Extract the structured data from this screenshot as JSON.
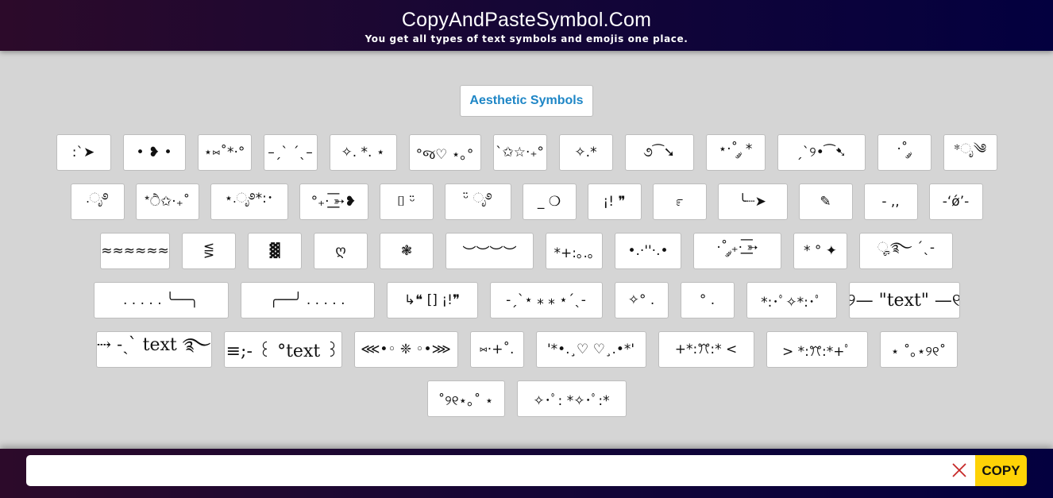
{
  "header": {
    "title": "CopyAndPasteSymbol.Com",
    "subtitle": "You get all types of text symbols and emojis one place."
  },
  "category": {
    "title": "Aesthetic Symbols"
  },
  "symbols": {
    "row1": [
      ":`➤",
      "• ❥ •",
      "⋆⑅˚*·°",
      "–ˏˋ ˊˎ–",
      "✧. *. ⋆",
      "°જ♡ ⋆｡°",
      "ˋ✩☆·₊°",
      "✧.*",
      "૭⁀➘",
      "⋆·˚ ༘ *",
      "ˏ`୨•⁀➷",
      "·˚ ༘",
      "*ೃ༄"
    ],
    "row2": [
      ".ೃ࿔",
      "*ੈ✩‧₊˚",
      "⋆.ೃ࿔*:･",
      "°₊· ͟͟͞➳❥",
      "⌷ ᵕ̈",
      "ᵕ̈ ೃ࿔",
      "_ ❍",
      "¡! ❞",
      "೯",
      "╰┈➤",
      "✎",
      "- ,,",
      "-‘ǿ’-"
    ],
    "row3": [
      "≈≈≈≈≈≈≈≈",
      "⋚",
      "▓",
      "ღ",
      "❃",
      "︶︶︶︶",
      "*+:｡.｡",
      "•.·''·.•",
      "·˚ ༘₊· ͟͟͞➳",
      "* ° ✦",
      "ೄ࿐ ˊˎ-"
    ],
    "row4": [
      ". . . . . ╰──╮",
      "╭──╯ . . . . .",
      "↳❝ [] ¡!❞",
      "-ˏˋ⋆ ⁎ ⁎ ⋆ˊˎ-",
      "✧° .",
      "° .",
      "*:･ﾟ✧*:･ﾟ",
      "୨— \"text\" —୧"
    ],
    "row5": [
      "⇢ ˗ˏˋ text ࿐",
      "≡;- ꒰ °text ꒱",
      "⋘•◦ ❈ ◦•⋙",
      "⑅·+˚.",
      "'*•.¸♡ ♡¸.•*'",
      "+*:ꔫ:* <",
      "> *:ꔫ:*+ﾟ",
      "⋆ ˚｡⋆୨୧˚"
    ],
    "row6": [
      "˚୨୧⋆｡˚ ⋆",
      "✧･ﾟ: *✧･ﾟ:*"
    ]
  },
  "copybar": {
    "input_value": "",
    "input_placeholder": "",
    "clear_icon": "close-icon",
    "copy_label": "COPY"
  },
  "colors": {
    "header_gradient_start": "#2c0a2a",
    "header_gradient_end": "#03003f",
    "accent_blue": "#1e86c6",
    "copy_yellow": "#fed206",
    "clear_red": "#c62828",
    "page_bg": "#d5d5d5"
  }
}
